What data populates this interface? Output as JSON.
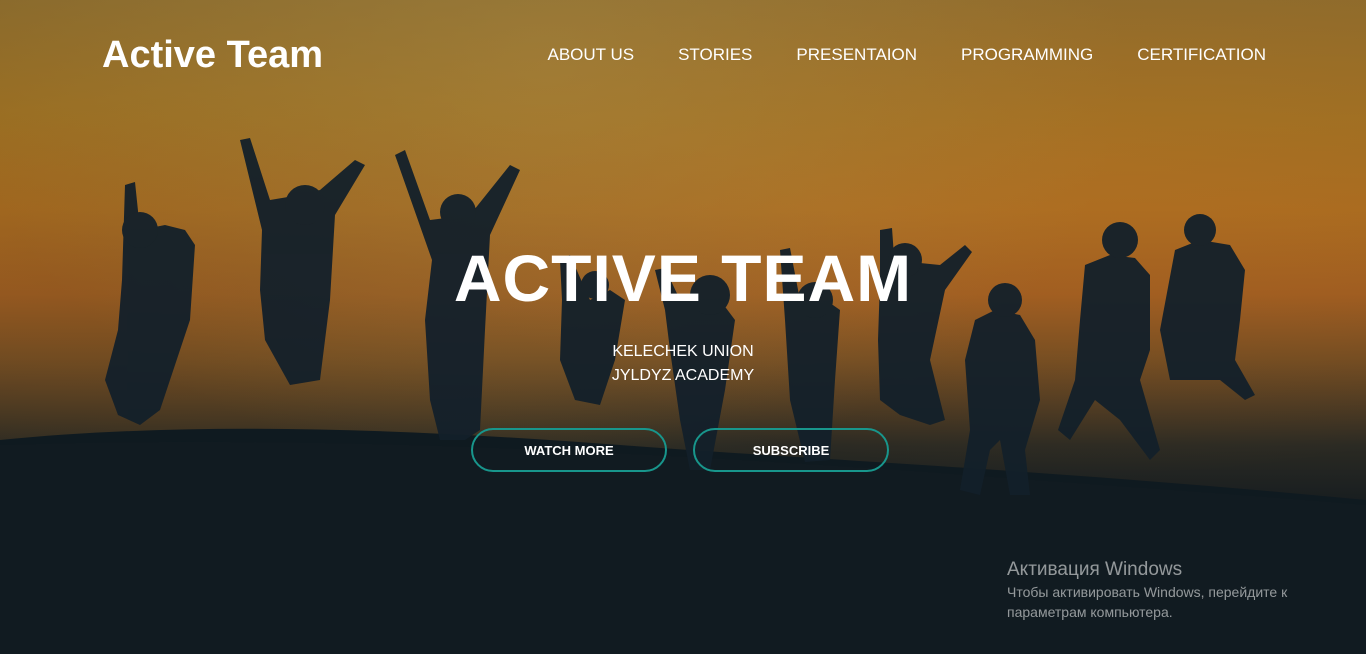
{
  "header": {
    "logo": "Active Team",
    "nav": [
      {
        "label": "ABOUT US"
      },
      {
        "label": "STORIES"
      },
      {
        "label": "PRESENTAION"
      },
      {
        "label": "PROGRAMMING"
      },
      {
        "label": "CERTIFICATION"
      }
    ]
  },
  "hero": {
    "title": "ACTIVE TEAM",
    "subtitle_line1": "KELECHEK UNION",
    "subtitle_line2": "JYLDYZ ACADEMY",
    "buttons": {
      "watch_more": "WATCH MORE",
      "subscribe": "SUBSCRIBE"
    },
    "image_description_icon": "jumping-people-silhouettes-image"
  },
  "windows_activation": {
    "title": "Активация Windows",
    "text": "Чтобы активировать Windows, перейдите к параметрам компьютера."
  },
  "colors": {
    "button_border": "#18968c",
    "text": "#ffffff",
    "dark_ground": "#0f1a20"
  }
}
